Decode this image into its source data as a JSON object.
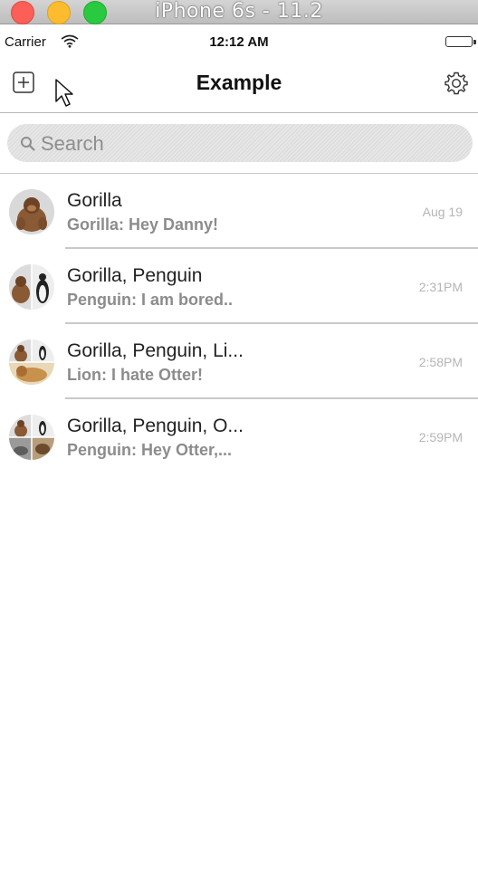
{
  "window": {
    "title": "iPhone 6s - 11.2"
  },
  "status_bar": {
    "carrier": "Carrier",
    "time": "12:12 AM"
  },
  "nav": {
    "title": "Example",
    "left_icon": "compose-icon",
    "right_icon": "gear-icon"
  },
  "search": {
    "placeholder": "Search"
  },
  "conversations": [
    {
      "title": "Gorilla",
      "preview": "Gorilla: Hey Danny!",
      "time": "Aug 19"
    },
    {
      "title": "Gorilla, Penguin",
      "preview": "Penguin: I am bored..",
      "time": "2:31PM"
    },
    {
      "title": "Gorilla, Penguin, Li...",
      "preview": "Lion: I hate Otter!",
      "time": "2:58PM"
    },
    {
      "title": "Gorilla, Penguin, O...",
      "preview": "Penguin: Hey Otter,...",
      "time": "2:59PM"
    }
  ]
}
